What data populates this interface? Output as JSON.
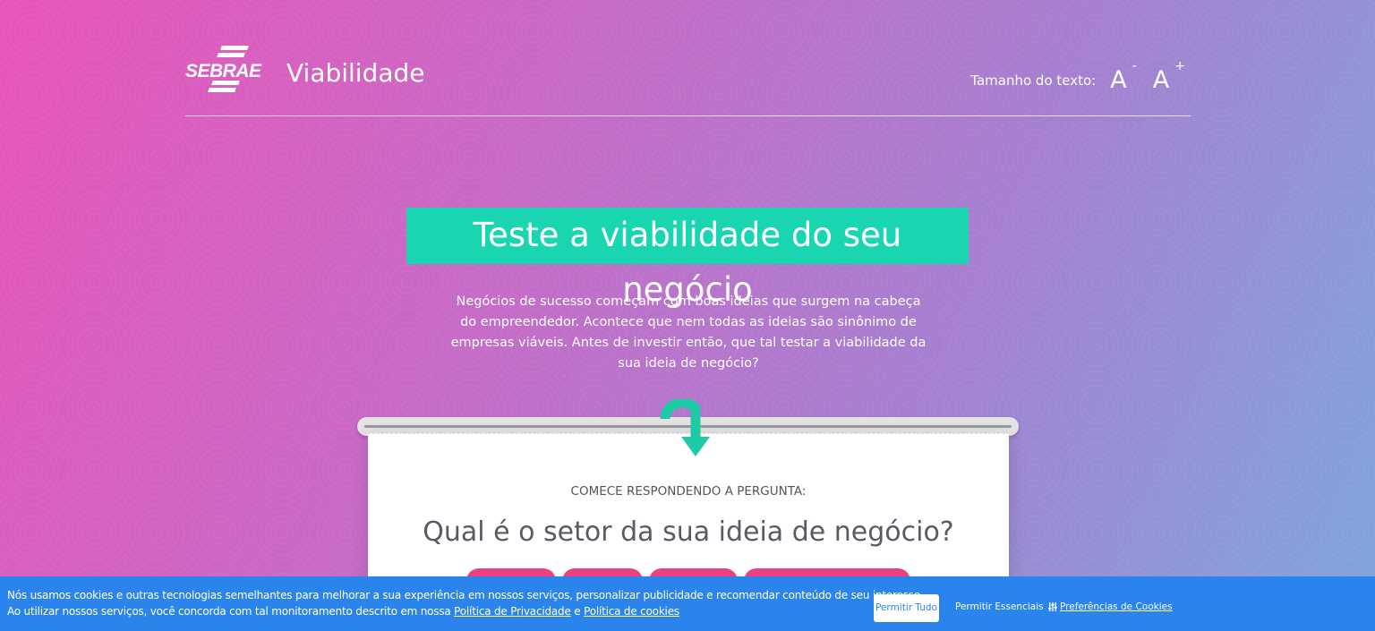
{
  "header": {
    "logo_text": "SEBRAE",
    "app_name": "Viabilidade",
    "text_size_label": "Tamanho do texto:",
    "decrease_label": "A",
    "decrease_sign": "-",
    "increase_label": "A",
    "increase_sign": "+"
  },
  "hero": {
    "title": "Teste a viabilidade do seu negócio",
    "description": "Negócios de sucesso começam com boas ideias que surgem na cabeça do empreendedor. Acontece que nem todas as ideias são sinônimo de empresas viáveis. Antes de investir então, que tal testar a viabilidade da sua ideia de negócio?"
  },
  "card": {
    "kicker": "COMECE RESPONDENDO A PERGUNTA:",
    "question": "Qual é o setor da sua ideia de negócio?"
  },
  "cookies": {
    "line1": "Nós usamos cookies e outras tecnologias semelhantes para melhorar a sua experiência em nossos serviços, personalizar publicidade e recomendar conteúdo de seu interesse.",
    "line2_prefix": "Ao utilizar nossos serviços, você concorda com tal monitoramento descrito em nossa ",
    "privacy_link": "Política de Privacidade",
    "and": " e ",
    "cookies_link": "Política de cookies",
    "allow_all": "Permitir Tudo",
    "allow_essential": "Permitir Essenciais",
    "preferences": "Preferências de Cookies"
  },
  "colors": {
    "accent_teal": "#1ad6b0",
    "option_pink": "#ee3f86",
    "cookie_blue": "#2b84ec"
  }
}
